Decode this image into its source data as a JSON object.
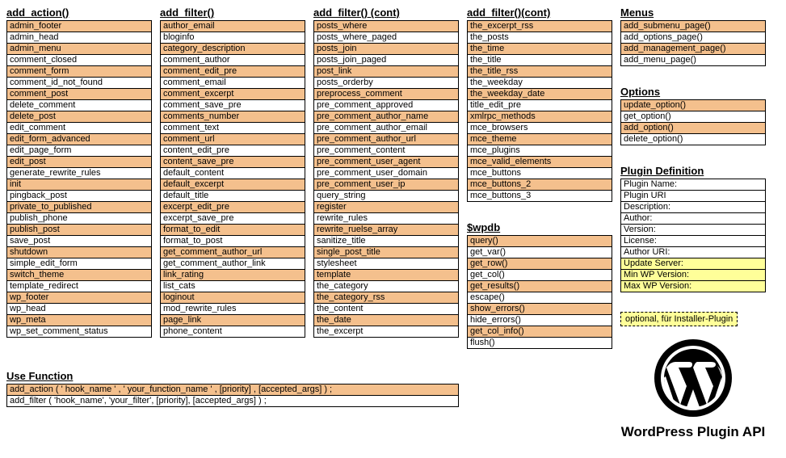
{
  "columns": {
    "add_action": {
      "title": "add_action()",
      "items": [
        {
          "t": "admin_footer",
          "c": "o"
        },
        {
          "t": "admin_head",
          "c": "w"
        },
        {
          "t": "admin_menu",
          "c": "o"
        },
        {
          "t": "comment_closed",
          "c": "w"
        },
        {
          "t": "comment_form",
          "c": "o"
        },
        {
          "t": "comment_id_not_found",
          "c": "w"
        },
        {
          "t": "comment_post",
          "c": "o"
        },
        {
          "t": "delete_comment",
          "c": "w"
        },
        {
          "t": "delete_post",
          "c": "o"
        },
        {
          "t": "edit_comment",
          "c": "w"
        },
        {
          "t": "edit_form_advanced",
          "c": "o"
        },
        {
          "t": "edit_page_form",
          "c": "w"
        },
        {
          "t": "edit_post",
          "c": "o"
        },
        {
          "t": "generate_rewrite_rules",
          "c": "w"
        },
        {
          "t": "init",
          "c": "o"
        },
        {
          "t": "pingback_post",
          "c": "w"
        },
        {
          "t": "private_to_published",
          "c": "o"
        },
        {
          "t": "publish_phone",
          "c": "w"
        },
        {
          "t": "publish_post",
          "c": "o"
        },
        {
          "t": "save_post",
          "c": "w"
        },
        {
          "t": "shutdown",
          "c": "o"
        },
        {
          "t": "simple_edit_form",
          "c": "w"
        },
        {
          "t": "switch_theme",
          "c": "o"
        },
        {
          "t": "template_redirect",
          "c": "w"
        },
        {
          "t": "wp_footer",
          "c": "o"
        },
        {
          "t": "wp_head",
          "c": "w"
        },
        {
          "t": "wp_meta",
          "c": "o"
        },
        {
          "t": "wp_set_comment_status",
          "c": "w"
        }
      ]
    },
    "add_filter1": {
      "title": "add_filter()",
      "items": [
        {
          "t": "author_email",
          "c": "o"
        },
        {
          "t": "bloginfo",
          "c": "w"
        },
        {
          "t": "category_description",
          "c": "o"
        },
        {
          "t": "comment_author",
          "c": "w"
        },
        {
          "t": "comment_edit_pre",
          "c": "o"
        },
        {
          "t": "comment_email",
          "c": "w"
        },
        {
          "t": "comment_excerpt",
          "c": "o"
        },
        {
          "t": "comment_save_pre",
          "c": "w"
        },
        {
          "t": "comments_number",
          "c": "o"
        },
        {
          "t": "comment_text",
          "c": "w"
        },
        {
          "t": "comment_url",
          "c": "o"
        },
        {
          "t": "content_edit_pre",
          "c": "w"
        },
        {
          "t": "content_save_pre",
          "c": "o"
        },
        {
          "t": "default_content",
          "c": "w"
        },
        {
          "t": "default_excerpt",
          "c": "o"
        },
        {
          "t": "default_title",
          "c": "w"
        },
        {
          "t": "excerpt_edit_pre",
          "c": "o"
        },
        {
          "t": "excerpt_save_pre",
          "c": "w"
        },
        {
          "t": "format_to_edit",
          "c": "o"
        },
        {
          "t": "format_to_post",
          "c": "w"
        },
        {
          "t": "get_comment_author_url",
          "c": "o"
        },
        {
          "t": "get_comment_author_link",
          "c": "w"
        },
        {
          "t": "link_rating",
          "c": "o"
        },
        {
          "t": "list_cats",
          "c": "w"
        },
        {
          "t": "loginout",
          "c": "o"
        },
        {
          "t": "mod_rewrite_rules",
          "c": "w"
        },
        {
          "t": "page_link",
          "c": "o"
        },
        {
          "t": "phone_content",
          "c": "w"
        }
      ]
    },
    "add_filter2": {
      "title": "add_filter() (cont)",
      "items": [
        {
          "t": "posts_where",
          "c": "o"
        },
        {
          "t": "posts_where_paged",
          "c": "w"
        },
        {
          "t": "posts_join",
          "c": "o"
        },
        {
          "t": "posts_join_paged",
          "c": "w"
        },
        {
          "t": "post_link",
          "c": "o"
        },
        {
          "t": "posts_orderby",
          "c": "w"
        },
        {
          "t": "preprocess_comment",
          "c": "o"
        },
        {
          "t": "pre_comment_approved",
          "c": "w"
        },
        {
          "t": "pre_comment_author_name",
          "c": "o"
        },
        {
          "t": "pre_comment_author_email",
          "c": "w"
        },
        {
          "t": "pre_comment_author_url",
          "c": "o"
        },
        {
          "t": "pre_comment_content",
          "c": "w"
        },
        {
          "t": "pre_comment_user_agent",
          "c": "o"
        },
        {
          "t": "pre_comment_user_domain",
          "c": "w"
        },
        {
          "t": "pre_comment_user_ip",
          "c": "o"
        },
        {
          "t": "query_string",
          "c": "w"
        },
        {
          "t": "register",
          "c": "o"
        },
        {
          "t": "rewrite_rules",
          "c": "w"
        },
        {
          "t": "rewrite_ruelse_array",
          "c": "o"
        },
        {
          "t": "sanitize_title",
          "c": "w"
        },
        {
          "t": "single_post_title",
          "c": "o"
        },
        {
          "t": "stylesheet",
          "c": "w"
        },
        {
          "t": "template",
          "c": "o"
        },
        {
          "t": "the_category",
          "c": "w"
        },
        {
          "t": "the_category_rss",
          "c": "o"
        },
        {
          "t": "the_content",
          "c": "w"
        },
        {
          "t": "the_date",
          "c": "o"
        },
        {
          "t": "the_excerpt",
          "c": "w"
        }
      ]
    },
    "add_filter3": {
      "title": "add_filter()(cont)",
      "items": [
        {
          "t": "the_excerpt_rss",
          "c": "o"
        },
        {
          "t": "the_posts",
          "c": "w"
        },
        {
          "t": "the_time",
          "c": "o"
        },
        {
          "t": "the_title",
          "c": "w"
        },
        {
          "t": "the_title_rss",
          "c": "o"
        },
        {
          "t": "the_weekday",
          "c": "w"
        },
        {
          "t": "the_weekday_date",
          "c": "o"
        },
        {
          "t": "title_edit_pre",
          "c": "w"
        },
        {
          "t": "xmlrpc_methods",
          "c": "o"
        },
        {
          "t": "mce_browsers",
          "c": "w"
        },
        {
          "t": "mce_theme",
          "c": "o"
        },
        {
          "t": "mce_plugins",
          "c": "w"
        },
        {
          "t": "mce_valid_elements",
          "c": "o"
        },
        {
          "t": "mce_buttons",
          "c": "w"
        },
        {
          "t": "mce_buttons_2",
          "c": "o"
        },
        {
          "t": "mce_buttons_3",
          "c": "w"
        }
      ]
    },
    "wpdb": {
      "title": "$wpdb",
      "items": [
        {
          "t": "query()",
          "c": "o"
        },
        {
          "t": "get_var()",
          "c": "w"
        },
        {
          "t": "get_row()",
          "c": "o"
        },
        {
          "t": "get_col()",
          "c": "w"
        },
        {
          "t": "get_results()",
          "c": "o"
        },
        {
          "t": "escape()",
          "c": "w"
        },
        {
          "t": "show_errors()",
          "c": "o"
        },
        {
          "t": "hide_errors()",
          "c": "w"
        },
        {
          "t": "get_col_info()",
          "c": "o"
        },
        {
          "t": "flush()",
          "c": "w"
        }
      ]
    },
    "menus": {
      "title": "Menus",
      "items": [
        {
          "t": "add_submenu_page()",
          "c": "o"
        },
        {
          "t": "add_options_page()",
          "c": "w"
        },
        {
          "t": "add_management_page()",
          "c": "o"
        },
        {
          "t": "add_menu_page()",
          "c": "w"
        }
      ]
    },
    "options": {
      "title": "Options",
      "items": [
        {
          "t": "update_option()",
          "c": "o"
        },
        {
          "t": "get_option()",
          "c": "w"
        },
        {
          "t": "add_option()",
          "c": "o"
        },
        {
          "t": "delete_option()",
          "c": "w"
        }
      ]
    },
    "plugin_def": {
      "title": "Plugin Definition",
      "items": [
        {
          "t": "Plugin Name:",
          "c": "w"
        },
        {
          "t": "Plugin URI",
          "c": "w"
        },
        {
          "t": "Description:",
          "c": "w"
        },
        {
          "t": "Author:",
          "c": "w"
        },
        {
          "t": "Version:",
          "c": "w"
        },
        {
          "t": "License:",
          "c": "w"
        },
        {
          "t": "Author URI:",
          "c": "w"
        },
        {
          "t": "Update Server:",
          "c": "y"
        },
        {
          "t": "Min WP Version:",
          "c": "y"
        },
        {
          "t": "Max WP Version:",
          "c": "y"
        }
      ]
    },
    "use_function": {
      "title": "Use Function",
      "items": [
        {
          "t": "add_action ( ' hook_name ' , ' your_function_name ' , [priority] , [accepted_args] ) ;",
          "c": "o"
        },
        {
          "t": "add_filter ( 'hook_name', 'your_filter', [priority], [accepted_args] ) ;",
          "c": "w"
        }
      ]
    }
  },
  "optional_note": "optional, für Installer-Plugin",
  "brand": "WordPress Plugin API"
}
